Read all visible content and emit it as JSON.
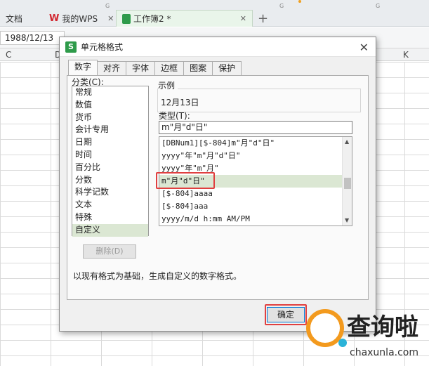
{
  "tabs": {
    "doc": "文档",
    "mywps": "我的WPS",
    "workbook": "工作簿2 *",
    "close_glyph": "✕",
    "plus": "+"
  },
  "formula_bar": {
    "cell_value": "1988/12/13"
  },
  "columns": {
    "c": "C",
    "d": "D",
    "k": "K"
  },
  "dialog": {
    "title": "单元格格式",
    "close_glyph": "✕",
    "tabs": [
      "数字",
      "对齐",
      "字体",
      "边框",
      "图案",
      "保护"
    ],
    "category_label": "分类(C):",
    "categories": [
      "常规",
      "数值",
      "货币",
      "会计专用",
      "日期",
      "时间",
      "百分比",
      "分数",
      "科学记数",
      "文本",
      "特殊",
      "自定义"
    ],
    "selected_category": "自定义",
    "sample_label": "示例",
    "sample_value": "12月13日",
    "type_label": "类型(T):",
    "type_value": "m\"月\"d\"日\"",
    "type_list": [
      "[DBNum1][$-804]m\"月\"d\"日\"",
      "yyyy\"年\"m\"月\"d\"日\"",
      "yyyy\"年\"m\"月\"",
      "m\"月\"d\"日\"",
      "[$-804]aaaa",
      "[$-804]aaa",
      "yyyy/m/d h:mm AM/PM"
    ],
    "selected_type": "m\"月\"d\"日\"",
    "delete_button": "删除(D)",
    "description": "以现有格式为基础，生成自定义的数字格式。",
    "ok_button": "确定"
  },
  "watermark": {
    "brand": "查询啦",
    "url": "chaxunla.com"
  },
  "colors": {
    "highlight": "#e04040",
    "selection": "#dbe7d3",
    "accent": "#0078d7"
  }
}
